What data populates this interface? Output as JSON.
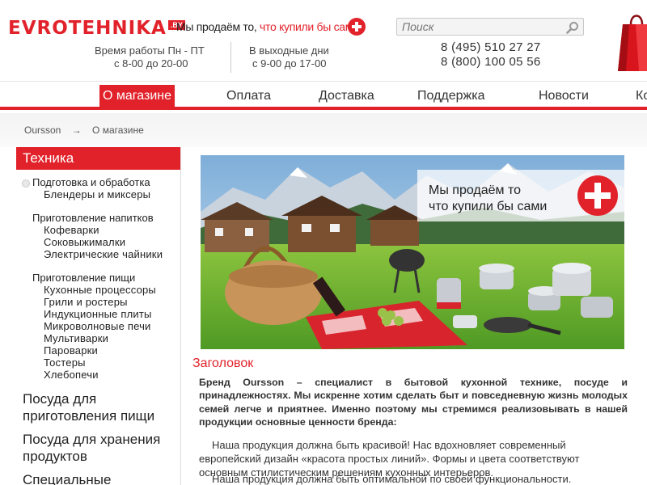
{
  "header": {
    "logo_text": "EVROTEHNIKA",
    "logo_suffix": ".BY",
    "slogan_part1": "Мы продаём то, ",
    "slogan_part2": "что купили бы сами",
    "hours_weekday_line1": "Время работы Пн - ПТ",
    "hours_weekday_line2": "с 8-00 до 20-00",
    "hours_weekend_line1": "В выходные дни",
    "hours_weekend_line2": "с  9-00 до 17-00",
    "search_placeholder": "Поиск",
    "phone1": "8 (495) 510 27 27",
    "phone2": "8 (800) 100 05 56"
  },
  "nav": {
    "items": [
      {
        "label": "О магазине",
        "active": true
      },
      {
        "label": "Оплата"
      },
      {
        "label": "Доставка"
      },
      {
        "label": "Поддержка"
      },
      {
        "label": "Новости"
      },
      {
        "label": "Ко"
      }
    ]
  },
  "breadcrumb": {
    "home": "Oursson",
    "separator": "→",
    "current": "О магазине"
  },
  "sidebar": {
    "title": "Техника",
    "groups": [
      {
        "category": "Подготовка и обработка",
        "items": [
          "Блендеры и миксеры"
        ]
      },
      {
        "category": "Приготовление напитков",
        "items": [
          "Кофеварки",
          "Соковыжималки",
          "Электрические чайники"
        ]
      },
      {
        "category": "Приготовление пищи",
        "items": [
          "Кухонные процессоры",
          "Грили и ростеры",
          "Индукционные плиты",
          "Микроволновые печи",
          "Мультиварки",
          "Пароварки",
          "Тостеры",
          "Хлебопечи"
        ]
      }
    ],
    "big_items": [
      "Посуда для приготовления пищи",
      "Посуда для хранения продуктов",
      "Специальные предложения"
    ]
  },
  "banner": {
    "line1": "Мы продаём то",
    "line2": "что купили бы сами"
  },
  "article": {
    "title": "Заголовок",
    "lead": "Бренд Oursson – специалист в бытовой кухонной технике, посуде и принадлежностях. Мы искренне хотим сделать быт и повседневную жизнь молодых семей легче и приятнее. Именно поэтому мы стремимся реализовывать в нашей продукции основные ценности бренда:",
    "p1_line1": "Наша продукция должна быть красивой! Нас вдохновляет современный",
    "p1_line2": "европейский дизайн «красота простых линий». Формы и цвета соответствуют",
    "p1_line3": "основным стилистическим решениям кухонных интерьеров.",
    "p2_line1": "Наша продукция должна быть оптимальной по своей функциональности."
  },
  "colors": {
    "brand_red": "#e2222b",
    "sky": "#9cc3e6",
    "grass": "#6fb43a"
  }
}
